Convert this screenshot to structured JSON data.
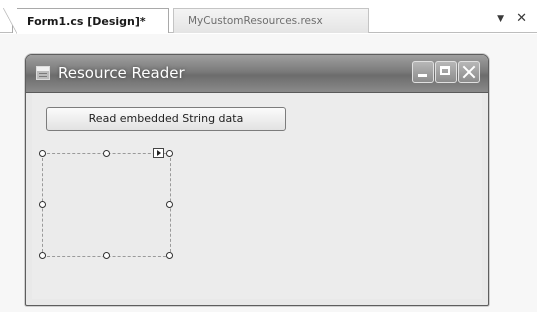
{
  "tabs": {
    "active_label": "Form1.cs [Design]*",
    "inactive_label": "MyCustomResources.resx"
  },
  "strip_controls": {
    "pin_icon": "▼",
    "close_icon": "✕"
  },
  "form": {
    "title": "Resource Reader",
    "icons": [
      "form-app-icon",
      "minimize-icon",
      "maximize-icon",
      "close-icon"
    ],
    "read_button_label": "Read embedded String data"
  },
  "picture_box": {
    "selected": true,
    "handle_icon": "grab-handle-icon",
    "smart_tag_icon": "smart-tag-arrow-icon"
  }
}
